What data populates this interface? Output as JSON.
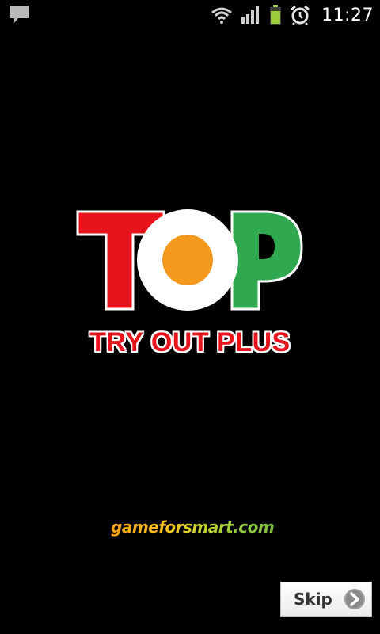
{
  "status_bar": {
    "time": "11:27",
    "icons": [
      "notification-icon",
      "wifi-icon",
      "signal-icon",
      "battery-icon",
      "alarm-icon"
    ]
  },
  "logo": {
    "word": "TOP",
    "subtitle": "TRY OUT PLUS",
    "colors": {
      "t": "#e8141b",
      "o_ring": "#ffffff",
      "o_center": "#f39a1e",
      "p": "#2fa84f"
    }
  },
  "brand": {
    "text": "gameforsmart.com"
  },
  "skip_button": {
    "label": "Skip",
    "icon": "chevron-right-icon"
  },
  "colors": {
    "background": "#000000",
    "subtitle": "#e8141b"
  }
}
